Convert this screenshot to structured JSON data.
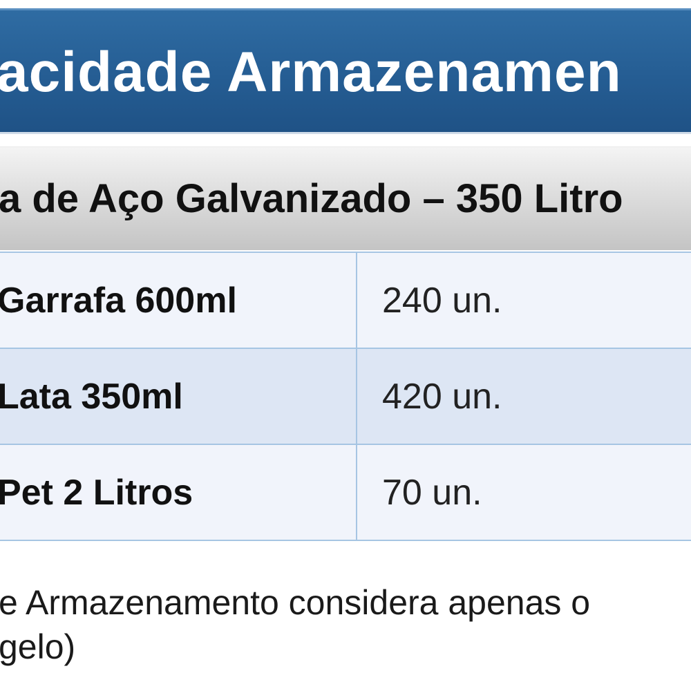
{
  "header": {
    "title": "acidade Armazenamen",
    "subtitle": "a de Aço Galvanizado – 350 Litro"
  },
  "colors": {
    "title_bar": "#255d93",
    "row_light": "#f1f4fb",
    "row_dark": "#dde6f4",
    "table_border": "#a6c5e3"
  },
  "table": {
    "rows": [
      {
        "item": "Garrafa 600ml",
        "quantity": "240 un."
      },
      {
        "item": "Lata 350ml",
        "quantity": "420 un."
      },
      {
        "item": "Pet 2 Litros",
        "quantity": "70 un."
      }
    ]
  },
  "footnote": {
    "line1": "e Armazenamento considera apenas o",
    "line2": "gelo)"
  }
}
